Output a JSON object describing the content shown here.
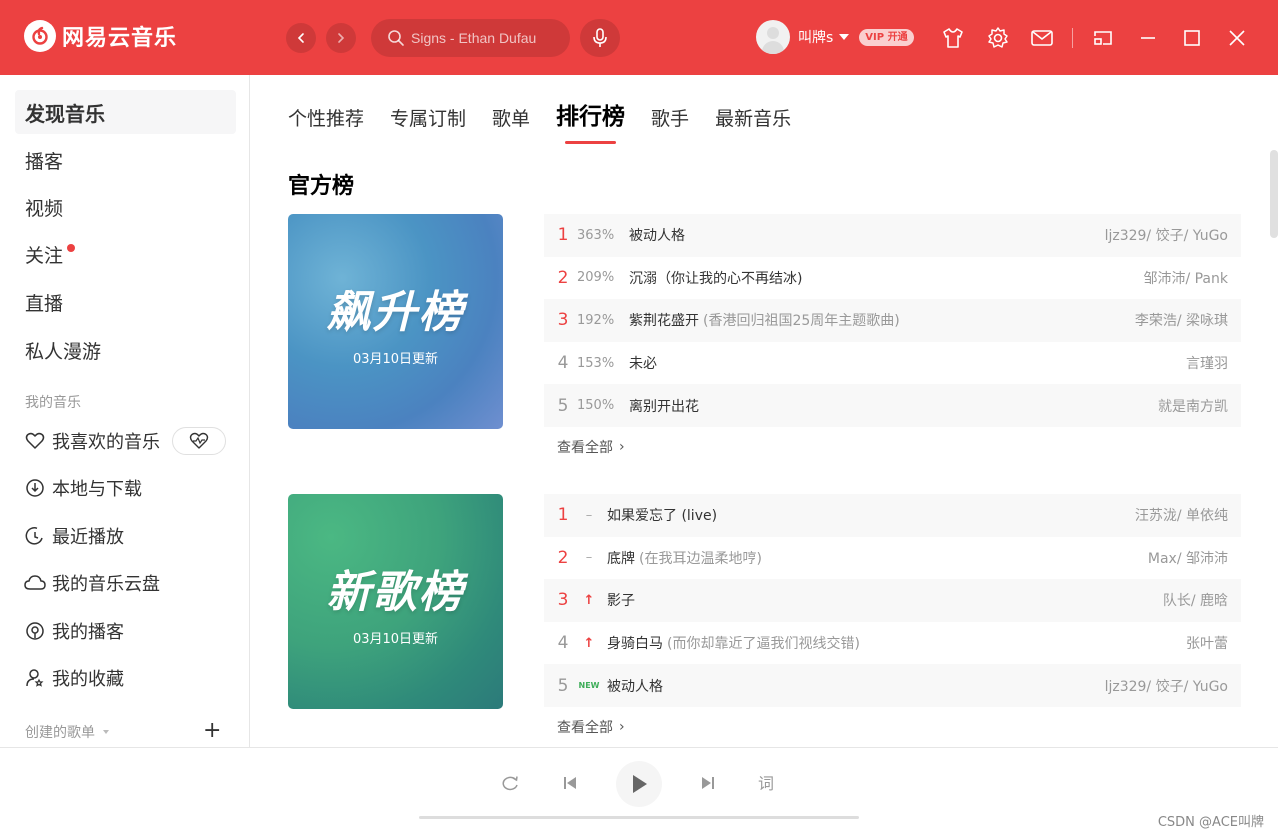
{
  "app": {
    "name": "网易云音乐",
    "brand_color": "#ec4141"
  },
  "header": {
    "search_placeholder": "Signs - Ethan Dufau",
    "username": "叫牌s",
    "vip_label": "VIP 开通"
  },
  "sidebar": {
    "main_items": [
      "发现音乐",
      "播客",
      "视频",
      "关注",
      "直播",
      "私人漫游"
    ],
    "my_music_title": "我的音乐",
    "my_music_items": [
      "我喜欢的音乐",
      "本地与下载",
      "最近播放",
      "我的音乐云盘",
      "我的播客",
      "我的收藏"
    ],
    "created_title": "创建的歌单"
  },
  "tabs": [
    "个性推荐",
    "专属订制",
    "歌单",
    "排行榜",
    "歌手",
    "最新音乐"
  ],
  "section_title": "官方榜",
  "charts": [
    {
      "cover_title": "飙升榜",
      "cover_date": "03月10日更新",
      "view_all": "查看全部",
      "rows": [
        {
          "rank": "1",
          "change": "363%",
          "song": "被动人格",
          "alt": "",
          "artist": "ljz329/ 饺子/ YuGo"
        },
        {
          "rank": "2",
          "change": "209%",
          "song": "沉溺（你让我的心不再结冰)",
          "alt": "",
          "artist": "邹沛沛/ Pank"
        },
        {
          "rank": "3",
          "change": "192%",
          "song": "紫荆花盛开",
          "alt": "(香港回归祖国25周年主题歌曲)",
          "artist": "李荣浩/ 梁咏琪"
        },
        {
          "rank": "4",
          "change": "153%",
          "song": "未必",
          "alt": "",
          "artist": "言瑾羽"
        },
        {
          "rank": "5",
          "change": "150%",
          "song": "离别开出花",
          "alt": "",
          "artist": "就是南方凯"
        }
      ]
    },
    {
      "cover_title": "新歌榜",
      "cover_date": "03月10日更新",
      "view_all": "查看全部",
      "rows": [
        {
          "rank": "1",
          "trend": "–",
          "song": "如果爱忘了 (live)",
          "alt": "",
          "artist": "汪苏泷/ 单依纯"
        },
        {
          "rank": "2",
          "trend": "–",
          "song": "底牌",
          "alt": "(在我耳边温柔地哼)",
          "artist": "Max/ 邹沛沛"
        },
        {
          "rank": "3",
          "trend": "↑",
          "song": "影子",
          "alt": "",
          "artist": "队长/ 鹿晗"
        },
        {
          "rank": "4",
          "trend": "↑",
          "song": "身骑白马",
          "alt": "(而你却靠近了逼我们视线交错)",
          "artist": "张叶蕾"
        },
        {
          "rank": "5",
          "trend": "NEW",
          "song": "被动人格",
          "alt": "",
          "artist": "ljz329/ 饺子/ YuGo"
        }
      ]
    }
  ],
  "player": {
    "lyric_label": "词"
  },
  "watermark": "CSDN @ACE叫牌"
}
